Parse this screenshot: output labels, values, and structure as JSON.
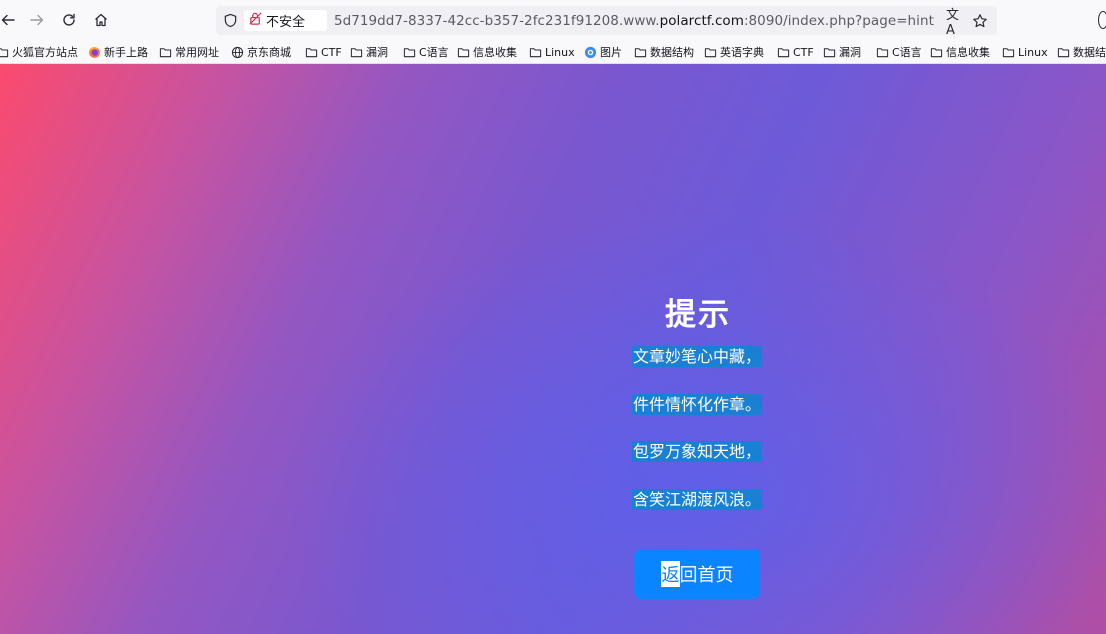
{
  "browser": {
    "insecure_label": "不安全",
    "url_prefix": "5d719dd7-8337-42cc-b357-2fc231f91208.www.",
    "url_domain": "polarctf.com",
    "url_suffix": ":8090/index.php?page=hint",
    "translate_glyph": "文A"
  },
  "bookmarks": [
    {
      "label": "火狐官方站点",
      "icon": "folder-icon"
    },
    {
      "label": "新手上路",
      "icon": "firefox-icon"
    },
    {
      "label": "常用网址",
      "icon": "folder-icon"
    },
    {
      "label": "京东商城",
      "icon": "globe-icon"
    },
    {
      "label": "CTF",
      "icon": "folder-icon"
    },
    {
      "label": "漏洞",
      "icon": "folder-icon"
    },
    {
      "label": "C语言",
      "icon": "folder-icon"
    },
    {
      "label": "信息收集",
      "icon": "folder-icon"
    },
    {
      "label": "Linux",
      "icon": "folder-icon"
    },
    {
      "label": "图片",
      "icon": "image-search-icon"
    },
    {
      "label": "数据结构",
      "icon": "folder-icon"
    },
    {
      "label": "英语字典",
      "icon": "folder-icon"
    },
    {
      "label": "CTF",
      "icon": "folder-icon"
    },
    {
      "label": "漏洞",
      "icon": "folder-icon"
    },
    {
      "label": "C语言",
      "icon": "folder-icon"
    },
    {
      "label": "信息收集",
      "icon": "folder-icon"
    },
    {
      "label": "Linux",
      "icon": "folder-icon"
    },
    {
      "label": "数据结",
      "icon": "folder-icon"
    }
  ],
  "page": {
    "title": "提示",
    "lines": [
      "文章妙笔心中藏，",
      "件件情怀化作章。",
      "包罗万象知天地，",
      "含笑江湖渡风浪。"
    ],
    "home_button_selected": "返",
    "home_button_rest": "回首页"
  },
  "colors": {
    "accent": "#0a84ff",
    "highlight": "#1682d2"
  }
}
